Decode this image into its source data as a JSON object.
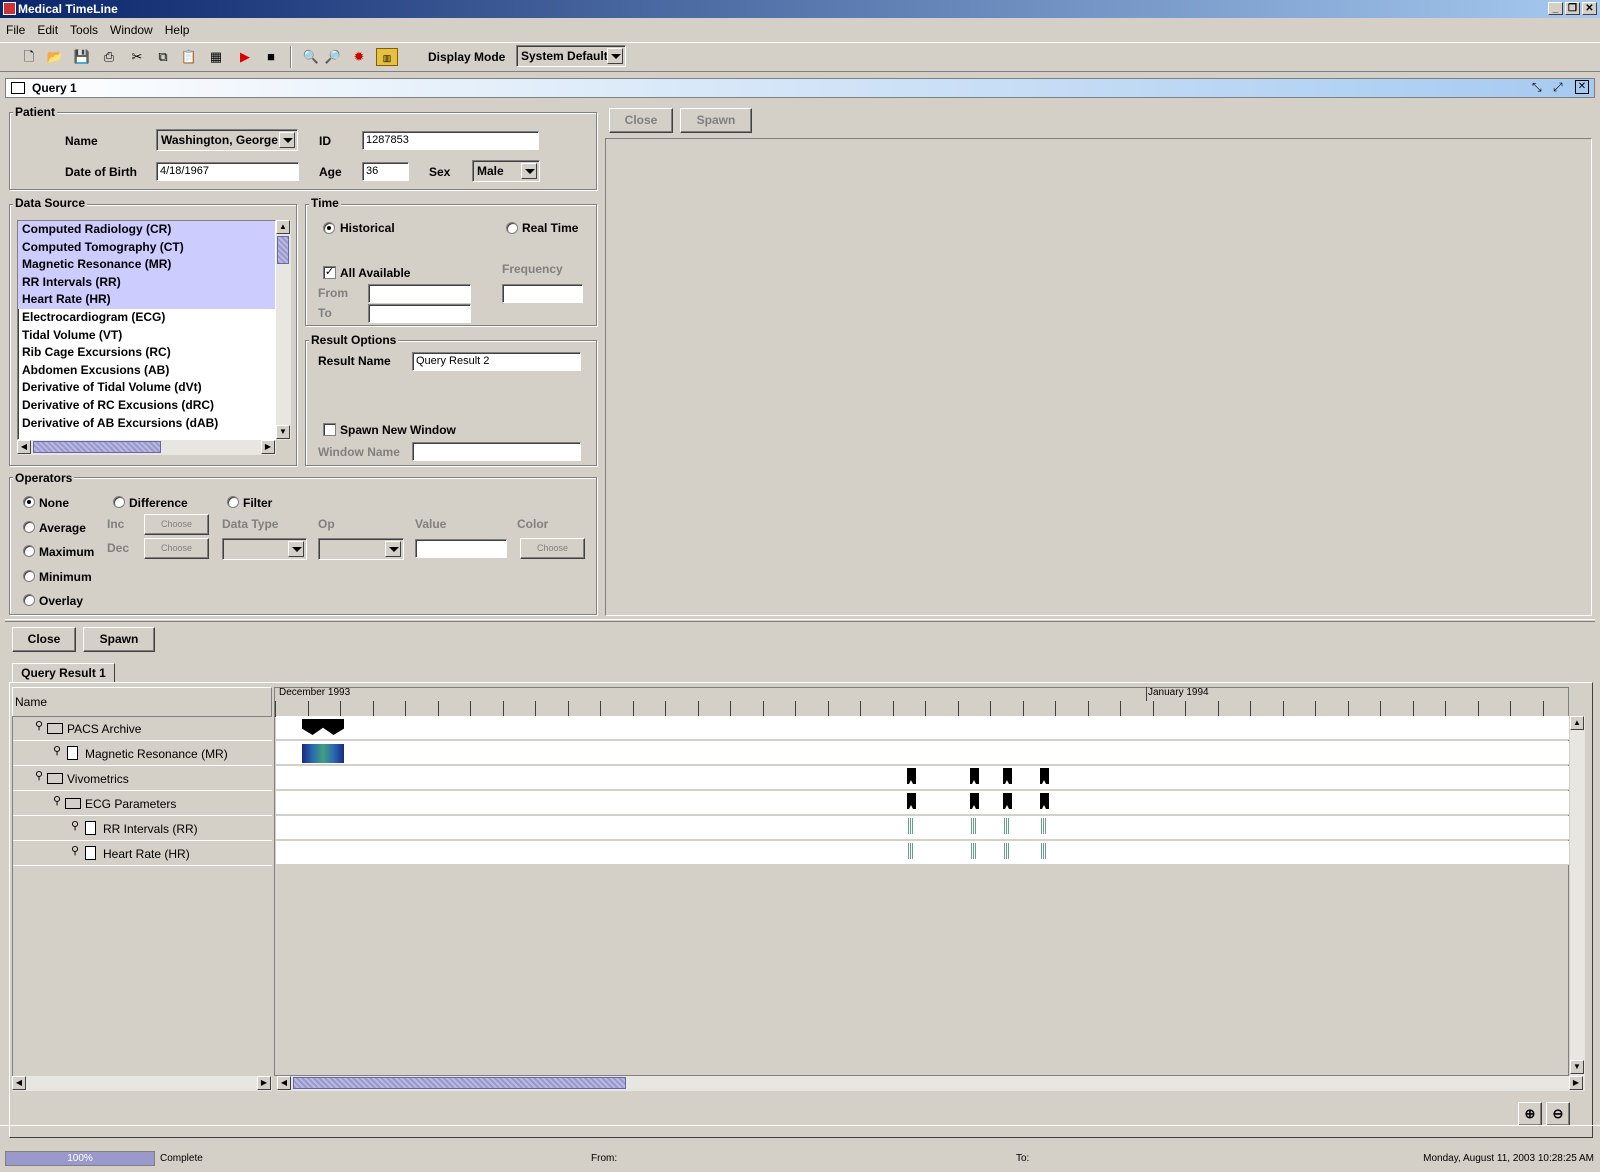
{
  "window": {
    "title": "Medical TimeLine"
  },
  "menu": [
    "File",
    "Edit",
    "Tools",
    "Window",
    "Help"
  ],
  "toolbar": {
    "icons": [
      "new-icon",
      "open-icon",
      "save-icon",
      "print-icon",
      "cut-icon",
      "copy-icon",
      "paste-icon",
      "table-icon",
      "play-icon",
      "stop-icon",
      "zoom-in-icon",
      "zoom-out-icon",
      "settings-icon",
      "chart-icon"
    ],
    "display_mode_label": "Display Mode",
    "display_mode_value": "System Default"
  },
  "query_frame": {
    "title": "Query 1"
  },
  "patient": {
    "group_label": "Patient",
    "name_label": "Name",
    "name_value": "Washington, George",
    "id_label": "ID",
    "id_value": "1287853",
    "dob_label": "Date of Birth",
    "dob_value": "4/18/1967",
    "age_label": "Age",
    "age_value": "36",
    "sex_label": "Sex",
    "sex_value": "Male"
  },
  "data_source": {
    "group_label": "Data Source",
    "items": [
      {
        "label": "Computed Radiology (CR)",
        "selected": true
      },
      {
        "label": "Computed Tomography (CT)",
        "selected": true
      },
      {
        "label": "Magnetic Resonance (MR)",
        "selected": true
      },
      {
        "label": "RR Intervals (RR)",
        "selected": true
      },
      {
        "label": "Heart Rate (HR)",
        "selected": true
      },
      {
        "label": "Electrocardiogram (ECG)",
        "selected": false
      },
      {
        "label": "Tidal Volume (VT)",
        "selected": false
      },
      {
        "label": "Rib Cage Excursions (RC)",
        "selected": false
      },
      {
        "label": "Abdomen Excusions (AB)",
        "selected": false
      },
      {
        "label": "Derivative of Tidal Volume (dVt)",
        "selected": false
      },
      {
        "label": "Derivative of RC Excusions (dRC)",
        "selected": false
      },
      {
        "label": "Derivative of AB Excursions (dAB)",
        "selected": false
      }
    ]
  },
  "time": {
    "group_label": "Time",
    "historical_label": "Historical",
    "realtime_label": "Real Time",
    "mode": "historical",
    "all_available_label": "All Available",
    "all_available": true,
    "frequency_label": "Frequency",
    "from_label": "From",
    "to_label": "To",
    "from_value": "",
    "to_value": "",
    "frequency_value": ""
  },
  "result_options": {
    "group_label": "Result Options",
    "result_name_label": "Result Name",
    "result_name_value": "Query Result 2",
    "spawn_label": "Spawn New Window",
    "spawn_checked": false,
    "window_name_label": "Window Name",
    "window_name_value": ""
  },
  "operators": {
    "group_label": "Operators",
    "radios": [
      "None",
      "Average",
      "Maximum",
      "Minimum",
      "Overlay"
    ],
    "selected": "None",
    "difference_label": "Difference",
    "filter_label": "Filter",
    "inc_label": "Inc",
    "dec_label": "Dec",
    "choose_label": "Choose",
    "data_type_label": "Data Type",
    "op_label": "Op",
    "value_label": "Value",
    "color_label": "Color",
    "value_value": ""
  },
  "right_panel": {
    "close_label": "Close",
    "spawn_label": "Spawn"
  },
  "result_panel": {
    "close_label": "Close",
    "spawn_label": "Spawn",
    "tab_label": "Query Result 1",
    "name_header": "Name",
    "month_labels": [
      "December 1993",
      "January 1994"
    ],
    "tree": [
      {
        "label": "PACS Archive",
        "level": 0,
        "type": "folder"
      },
      {
        "label": "Magnetic Resonance (MR)",
        "level": 1,
        "type": "file"
      },
      {
        "label": "Vivometrics",
        "level": 0,
        "type": "folder"
      },
      {
        "label": "ECG Parameters",
        "level": 1,
        "type": "folder"
      },
      {
        "label": "RR Intervals (RR)",
        "level": 2,
        "type": "file"
      },
      {
        "label": "Heart Rate (HR)",
        "level": 2,
        "type": "file"
      }
    ]
  },
  "status": {
    "progress": 1.0,
    "progress_text": "100%",
    "complete_text": "Complete",
    "from_label": "From:",
    "to_label": "To:",
    "datetime": "Monday, August 11, 2003 10:28:25 AM"
  },
  "colors": {
    "selection": "#ccccff",
    "titlebar": "#0a246a",
    "progress": "#9999cc"
  }
}
